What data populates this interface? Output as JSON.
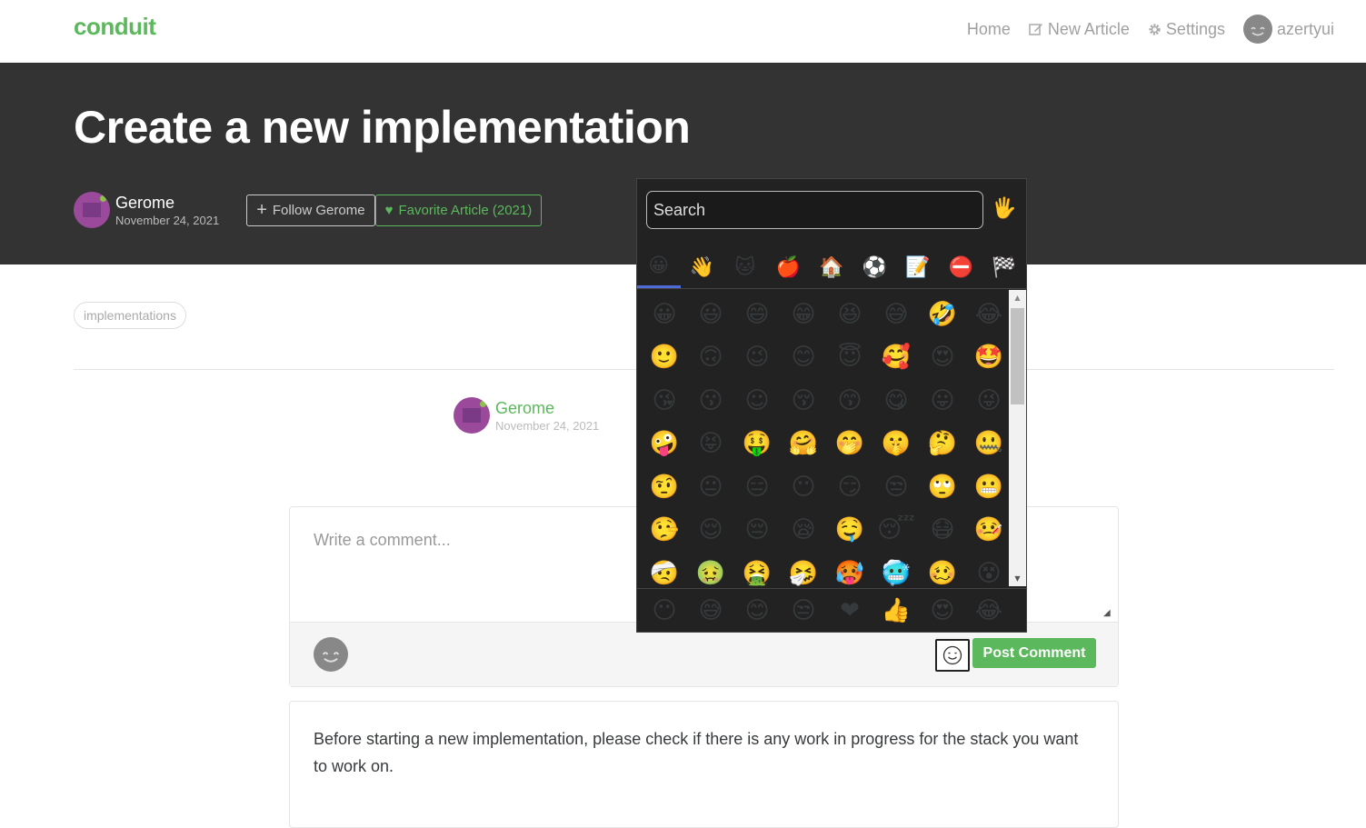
{
  "nav": {
    "brand": "conduit",
    "home": "Home",
    "new_article": "New Article",
    "settings": "Settings",
    "username": "azertyui"
  },
  "article": {
    "title": "Create a new implementation",
    "author": "Gerome",
    "date": "November 24, 2021",
    "follow_label": "Follow Gerome",
    "favorite_label": "Favorite Article (2021)",
    "tag": "implementations",
    "body": "Before starting a new implementation, please check if there is any work in progress for the stack you want to work on."
  },
  "comment_form": {
    "placeholder": "Write a comment...",
    "post_label": "Post Comment"
  },
  "emoji_picker": {
    "search_placeholder": "Search",
    "skin_tone": "🖐",
    "categories": [
      "😀",
      "👋",
      "🐱",
      "🍎",
      "🏠",
      "⚽",
      "📝",
      "⛔",
      "🏁"
    ],
    "active_category": 0,
    "grid": [
      [
        "😀",
        "😃",
        "😄",
        "😁",
        "😆",
        "😅",
        "🤣",
        "😂"
      ],
      [
        "🙂",
        "🙃",
        "😉",
        "😊",
        "😇",
        "🥰",
        "😍",
        "🤩"
      ],
      [
        "😘",
        "😗",
        "☺",
        "😚",
        "😙",
        "😋",
        "😛",
        "😜"
      ],
      [
        "🤪",
        "😝",
        "🤑",
        "🤗",
        "🤭",
        "🤫",
        "🤔",
        "🤐"
      ],
      [
        "🤨",
        "😐",
        "😑",
        "😶",
        "😏",
        "😒",
        "🙄",
        "😬"
      ],
      [
        "🤥",
        "😌",
        "😔",
        "😪",
        "🤤",
        "😴",
        "😷",
        "🤒"
      ],
      [
        "🤕",
        "🤢",
        "🤮",
        "🤧",
        "🥵",
        "🥶",
        "🥴",
        "😵"
      ]
    ],
    "recent": [
      "😶",
      "😅",
      "😊",
      "😒",
      "❤",
      "👍",
      "😍",
      "😂"
    ]
  }
}
